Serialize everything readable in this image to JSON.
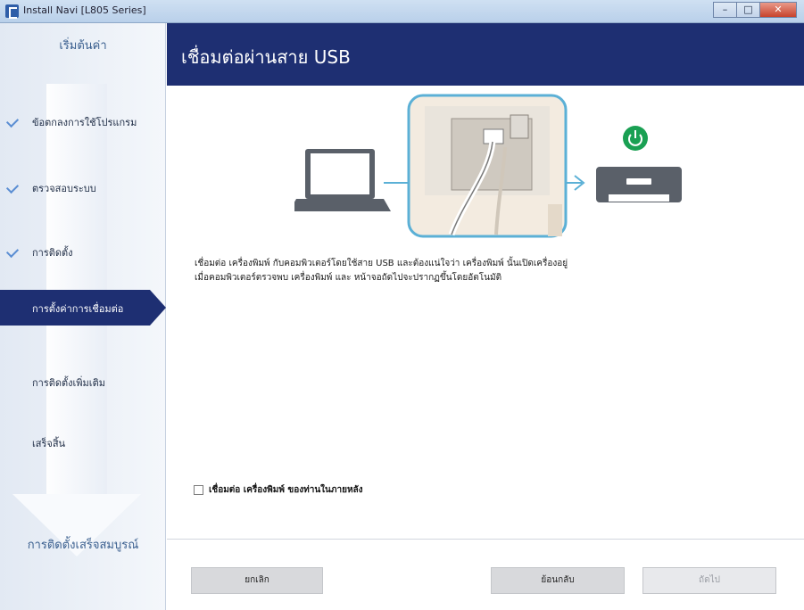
{
  "window": {
    "title": "Install Navi [L805 Series]",
    "controls": [
      "–",
      "□",
      "✕"
    ]
  },
  "sidebar": {
    "top_label": "เริ่มต้นค่า",
    "items": [
      {
        "label": "ข้อตกลงการใช้โปรแกรม",
        "done": true
      },
      {
        "label": "ตรวจสอบระบบ",
        "done": true
      },
      {
        "label": "การติดตั้ง",
        "done": true
      },
      {
        "label": "การตั้งค่าการเชื่อมต่อ",
        "active": true
      },
      {
        "label": "การติดตั้งเพิ่มเติม"
      },
      {
        "label": "เสร็จสิ้น"
      }
    ],
    "bottom_label": "การติดตั้งเสร็จสมบูรณ์"
  },
  "main": {
    "title": "เชื่อมต่อผ่านสาย USB",
    "description_line1": "เชื่อมต่อ เครื่องพิมพ์ กับคอมพิวเตอร์โดยใช้สาย USB และต้องแน่ใจว่า เครื่องพิมพ์ นั้นเปิดเครื่องอยู่",
    "description_line2": "เมื่อคอมพิวเตอร์ตรวจพบ เครื่องพิมพ์ และ หน้าจอถัดไปจะปรากฏขึ้นโดยอัตโนมัติ",
    "checkbox_label": "เชื่อมต่อ เครื่องพิมพ์ ของท่านในภายหลัง"
  },
  "footer": {
    "cancel_label": "ยกเลิก",
    "back_label": "ย้อนกลับ",
    "next_label": "ถัดไป"
  },
  "colors": {
    "accent": "#1e2f72",
    "power": "#1aa053",
    "callout": "#5bb0d6"
  },
  "icons": [
    "laptop-icon",
    "printer-icon",
    "power-icon",
    "usb-cable-icon",
    "arrow-right-icon",
    "check-icon"
  ]
}
